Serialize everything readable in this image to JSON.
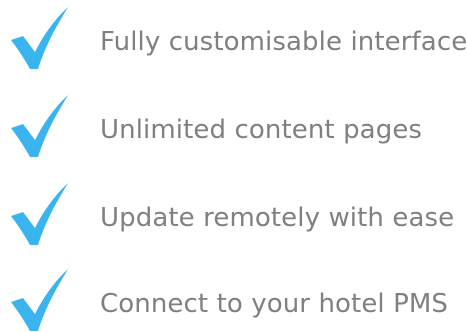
{
  "icon_color": "#3ab4ee",
  "icon": "checkmark-icon",
  "features": [
    {
      "label": "Fully customisable interface"
    },
    {
      "label": "Unlimited content pages"
    },
    {
      "label": "Update remotely with ease"
    },
    {
      "label": "Connect to your hotel PMS"
    }
  ]
}
